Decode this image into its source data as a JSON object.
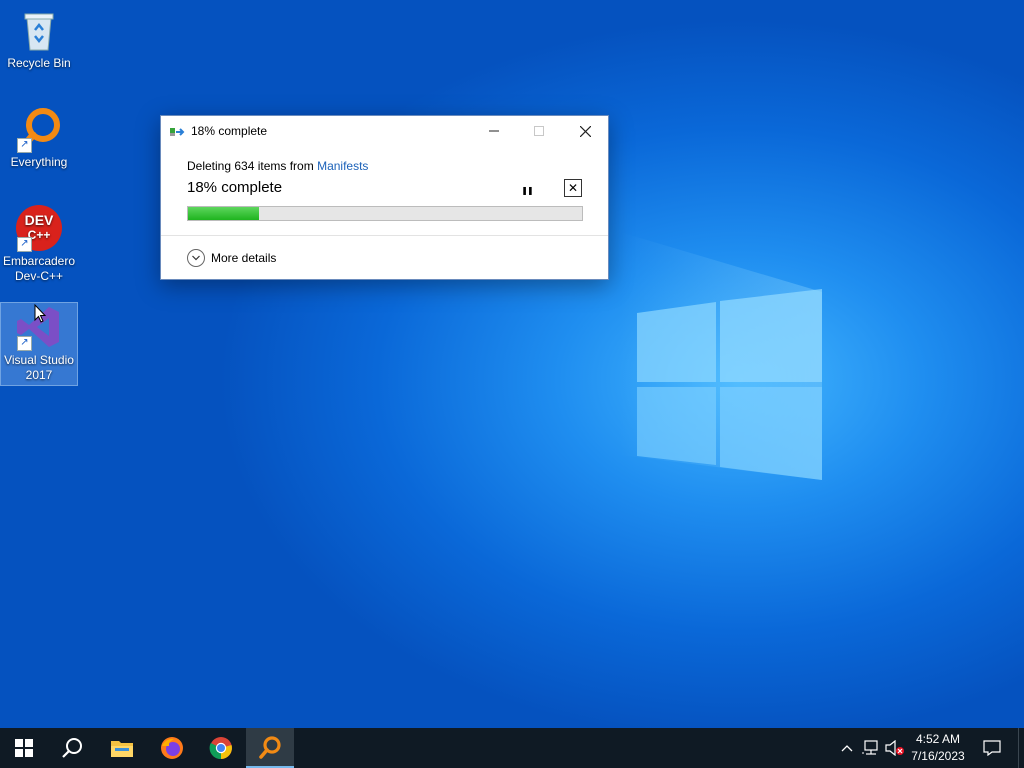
{
  "desktop_icons": [
    {
      "label": "Recycle Bin"
    },
    {
      "label": "Everything"
    },
    {
      "label": "Embarcadero Dev-C++"
    },
    {
      "label": "Visual Studio 2017"
    }
  ],
  "dialog": {
    "title": "18% complete",
    "deleting_prefix": "Deleting 634 items from",
    "source_folder": "Manifests",
    "percent_text": "18% complete",
    "progress_fraction": 0.18,
    "more_details": "More details",
    "pause_glyph": "❚❚",
    "cancel_glyph": "✕"
  },
  "taskbar": {
    "apps": [
      "start-icon",
      "search-icon",
      "file-explorer-icon",
      "firefox-icon",
      "chrome-icon",
      "everything-icon"
    ],
    "clock_time": "4:52 AM",
    "clock_date": "7/16/2023"
  },
  "colors": {
    "progress_fill": "#1fb41f",
    "link": "#1c62b9",
    "taskbar": "#0f1a24"
  }
}
